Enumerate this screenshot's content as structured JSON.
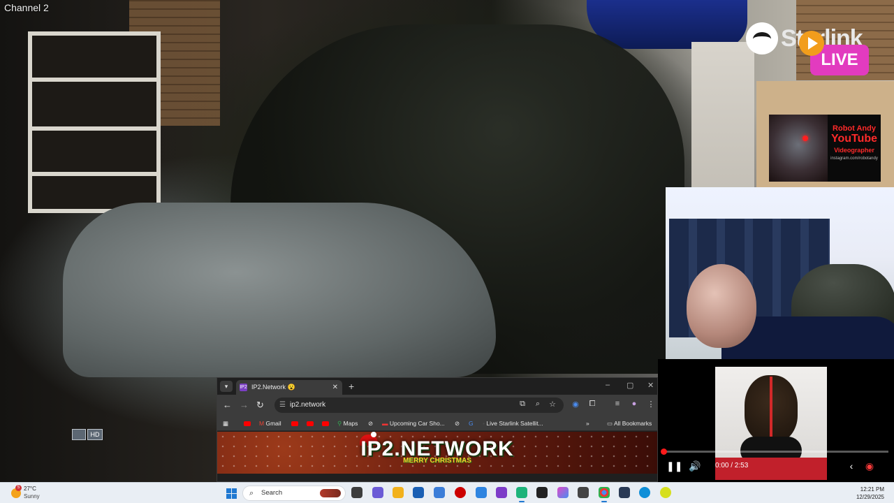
{
  "camera": {
    "channel_label": "Channel 2",
    "quality_badge": [
      "",
      "HD"
    ]
  },
  "stream_overlay": {
    "brand_text": "Starlink",
    "live_badge": "LIVE",
    "promo": {
      "line1": "Robot Andy",
      "line2": "YouTube",
      "line3": "Videographer",
      "line4": "instagram.com/robotandy"
    }
  },
  "video_player": {
    "time": "0:00 / 2:53",
    "progress": 0.01,
    "icons": [
      "pause-icon",
      "volume-icon",
      "chevron-left-icon",
      "logo-icon"
    ]
  },
  "browser": {
    "tab_title": "IP2.Network 😮",
    "tab_favicon": "IP2",
    "new_tab": "+",
    "window_controls": [
      "–",
      "▢",
      "✕"
    ],
    "address": "ip2.network",
    "bookmarks": {
      "gmail": "Gmail",
      "maps": "Maps",
      "upcoming": "Upcoming Car Sho...",
      "starlink": "Live Starlink Satellit...",
      "more": "»",
      "all": "All Bookmarks"
    },
    "banner_title": "IP2.NETWORK",
    "banner_subtitle": "MERRY CHRISTMAS"
  },
  "taskbar": {
    "weather_temp": "27°C",
    "weather_condition": "Sunny",
    "weather_alert": "5",
    "search_placeholder": "Search",
    "time": "12:21 PM",
    "date": "12/29/2025",
    "colors": {
      "accent": "#1f78d1"
    }
  }
}
